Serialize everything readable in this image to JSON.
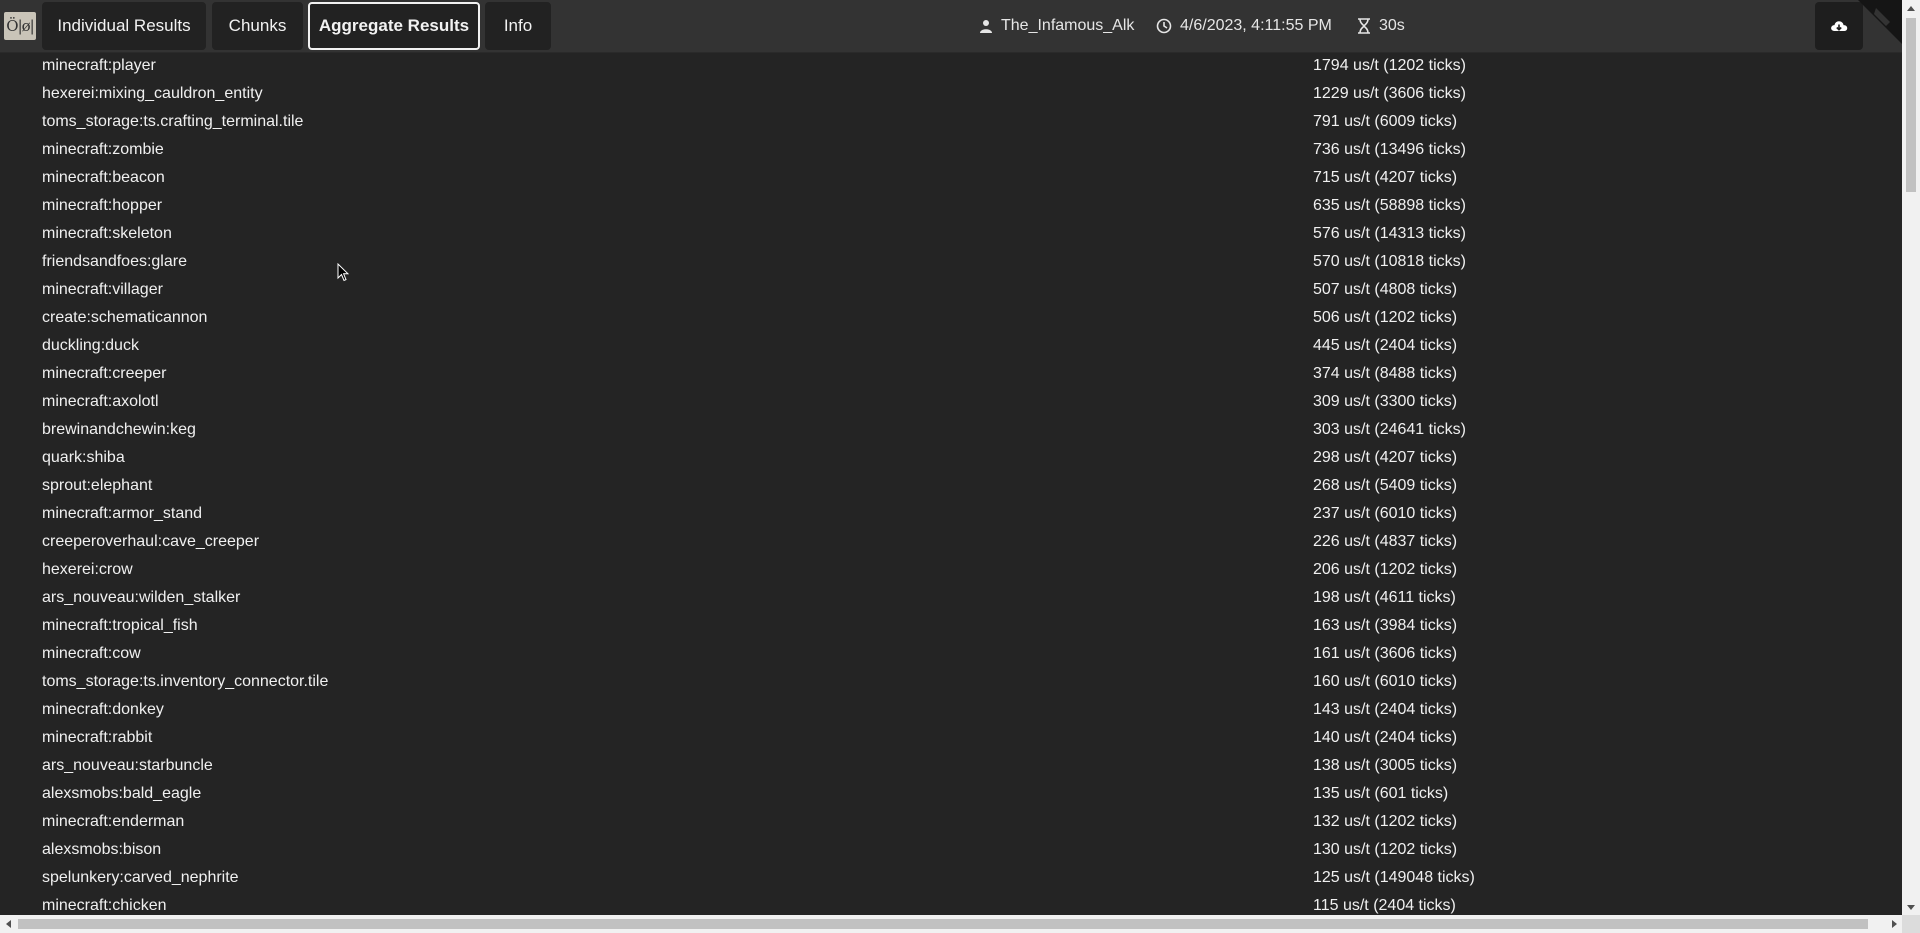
{
  "tabs": [
    {
      "label": "Individual Results",
      "active": false
    },
    {
      "label": "Chunks",
      "active": false
    },
    {
      "label": "Aggregate Results",
      "active": true
    },
    {
      "label": "Info",
      "active": false
    }
  ],
  "header": {
    "logo_text": "Ö|ø|",
    "user": "The_Infamous_Alk",
    "timestamp": "4/6/2023, 4:11:55 PM",
    "duration": "30s",
    "user_icon": "user-icon",
    "clock_icon": "clock-icon",
    "duration_icon": "hourglass-icon",
    "download_icon": "cloud-download-icon"
  },
  "results": [
    {
      "name": "minecraft:player",
      "value": "1794 us/t (1202 ticks)"
    },
    {
      "name": "hexerei:mixing_cauldron_entity",
      "value": "1229 us/t (3606 ticks)"
    },
    {
      "name": "toms_storage:ts.crafting_terminal.tile",
      "value": "791 us/t (6009 ticks)"
    },
    {
      "name": "minecraft:zombie",
      "value": "736 us/t (13496 ticks)"
    },
    {
      "name": "minecraft:beacon",
      "value": "715 us/t (4207 ticks)"
    },
    {
      "name": "minecraft:hopper",
      "value": "635 us/t (58898 ticks)"
    },
    {
      "name": "minecraft:skeleton",
      "value": "576 us/t (14313 ticks)"
    },
    {
      "name": "friendsandfoes:glare",
      "value": "570 us/t (10818 ticks)"
    },
    {
      "name": "minecraft:villager",
      "value": "507 us/t (4808 ticks)"
    },
    {
      "name": "create:schematicannon",
      "value": "506 us/t (1202 ticks)"
    },
    {
      "name": "duckling:duck",
      "value": "445 us/t (2404 ticks)"
    },
    {
      "name": "minecraft:creeper",
      "value": "374 us/t (8488 ticks)"
    },
    {
      "name": "minecraft:axolotl",
      "value": "309 us/t (3300 ticks)"
    },
    {
      "name": "brewinandchewin:keg",
      "value": "303 us/t (24641 ticks)"
    },
    {
      "name": "quark:shiba",
      "value": "298 us/t (4207 ticks)"
    },
    {
      "name": "sprout:elephant",
      "value": "268 us/t (5409 ticks)"
    },
    {
      "name": "minecraft:armor_stand",
      "value": "237 us/t (6010 ticks)"
    },
    {
      "name": "creeperoverhaul:cave_creeper",
      "value": "226 us/t (4837 ticks)"
    },
    {
      "name": "hexerei:crow",
      "value": "206 us/t (1202 ticks)"
    },
    {
      "name": "ars_nouveau:wilden_stalker",
      "value": "198 us/t (4611 ticks)"
    },
    {
      "name": "minecraft:tropical_fish",
      "value": "163 us/t (3984 ticks)"
    },
    {
      "name": "minecraft:cow",
      "value": "161 us/t (3606 ticks)"
    },
    {
      "name": "toms_storage:ts.inventory_connector.tile",
      "value": "160 us/t (6010 ticks)"
    },
    {
      "name": "minecraft:donkey",
      "value": "143 us/t (2404 ticks)"
    },
    {
      "name": "minecraft:rabbit",
      "value": "140 us/t (2404 ticks)"
    },
    {
      "name": "ars_nouveau:starbuncle",
      "value": "138 us/t (3005 ticks)"
    },
    {
      "name": "alexsmobs:bald_eagle",
      "value": "135 us/t (601 ticks)"
    },
    {
      "name": "minecraft:enderman",
      "value": "132 us/t (1202 ticks)"
    },
    {
      "name": "alexsmobs:bison",
      "value": "130 us/t (1202 ticks)"
    },
    {
      "name": "spelunkery:carved_nephrite",
      "value": "125 us/t (149048 ticks)"
    },
    {
      "name": "minecraft:chicken",
      "value": "115 us/t (2404 ticks)"
    }
  ]
}
